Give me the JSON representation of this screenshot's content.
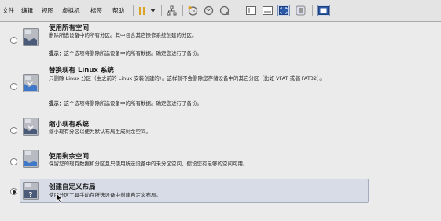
{
  "menubar": {
    "items": [
      "文件",
      "编辑",
      "视图",
      "虚拟机",
      "标签",
      "帮助"
    ]
  },
  "toolbar": {
    "icons": [
      "pause-icon",
      "dropdown-icon",
      "network-icon",
      "snapshot-icon",
      "revert-snapshot-icon",
      "manage-snapshots-icon",
      "normal-view-icon",
      "console-view-icon",
      "fullscreen-icon",
      "unity-icon",
      "thumbnail-icon"
    ]
  },
  "colors": {
    "topbar": "#e4e4e4",
    "content_bg": "#ebebeb",
    "selected_bg": "#d7dce6",
    "selected_border": "#a4acbd",
    "toolbar_accent": "#2d5aa8",
    "disk_icon": "#4a5a78"
  },
  "options": [
    {
      "title": "使用所有空间",
      "desc": "删除所选设备中的所有分区。其中包含其它操作系统创建的分区。",
      "tip_label": "提示：",
      "tip": "这个选项将删除所选设备中的所有数据。确定您进行了备份。",
      "icon": "disk-icon",
      "checked": false
    },
    {
      "title": "替换现有 Linux 系统",
      "desc": "只删除 Linux 分区（由之前的 Linux 安装创建的）。这样就不会删除您存储设备中的其它分区（比如 VFAT 或者 FAT32）。",
      "tip_label": "提示：",
      "tip": "这个选项将删除所选设备中的所有数据。确定您进行了备份。",
      "icon": "disk-replace-icon",
      "checked": false
    },
    {
      "title": "缩小现有系统",
      "desc": "缩小现有分区以便为默认布局生成剩余空间。",
      "icon": "disk-shrink-icon",
      "checked": false
    },
    {
      "title": "使用剩余空间",
      "desc": "保留您的现有数据和分区且只使用所选设备中的未分区空间，假设您有足够的空间可用。",
      "icon": "disk-free-space-icon",
      "checked": false
    },
    {
      "title": "创建自定义布局",
      "desc": "使用分区工具手动在所选设备中创建自定义布局。",
      "icon": "custom-layout-icon",
      "checked": true
    }
  ]
}
